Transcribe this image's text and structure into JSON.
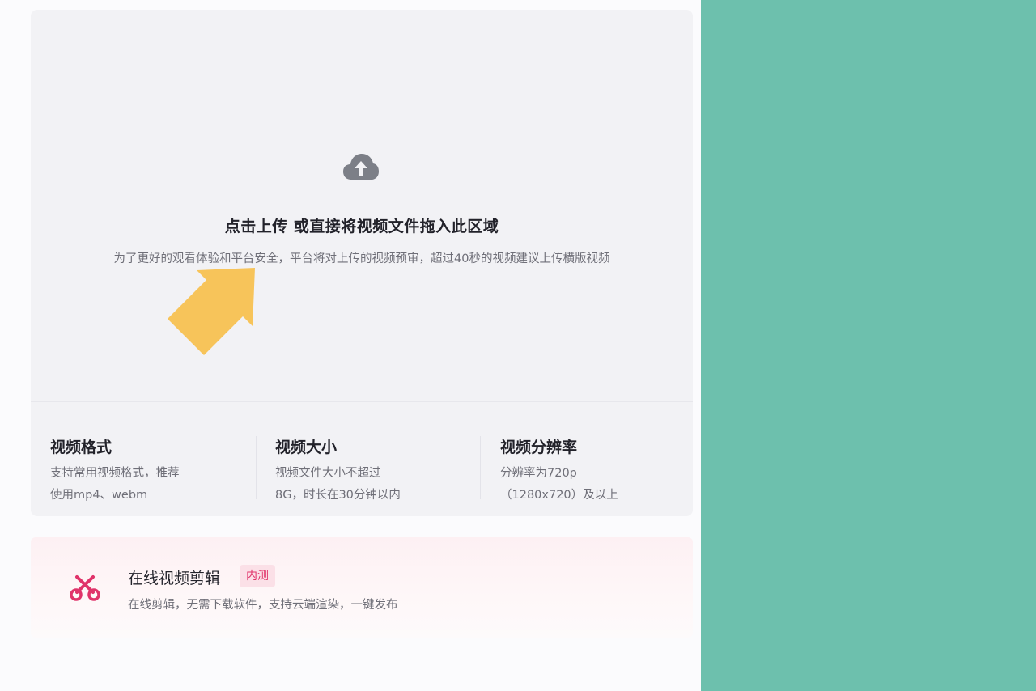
{
  "upload": {
    "title": "点击上传 或直接将视频文件拖入此区域",
    "note": "为了更好的观看体验和平台安全，平台将对上传的视频预审，超过40秒的视频建议上传横版视频",
    "icon": "cloud-upload-icon",
    "hint_icon": "arrow-pointer-icon"
  },
  "specs": [
    {
      "title": "视频格式",
      "line1": "支持常用视频格式，推荐",
      "line2": "使用mp4、webm"
    },
    {
      "title": "视频大小",
      "line1": "视频文件大小不超过",
      "line2": "8G，时长在30分钟以内"
    },
    {
      "title": "视频分辨率",
      "line1": "分辨率为720p",
      "line2": "（1280x720）及以上"
    }
  ],
  "editor": {
    "title": "在线视频剪辑",
    "badge": "内测",
    "desc": "在线剪辑，无需下载软件，支持云端渲染，一键发布",
    "icon": "scissors-icon"
  },
  "colors": {
    "accent": "#e0336a",
    "arrow": "#f7c45a",
    "right_panel": "#6dc0ad",
    "card_bg": "#f2f2f5"
  }
}
